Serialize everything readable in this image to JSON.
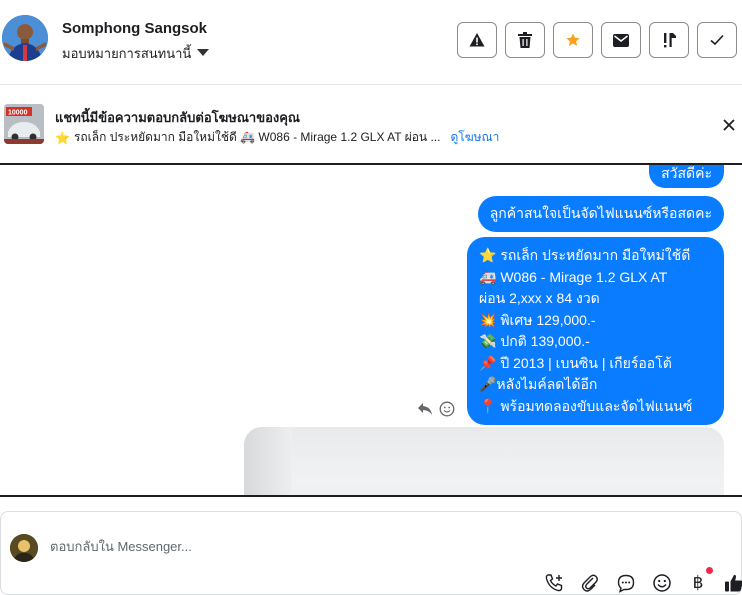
{
  "header": {
    "contact_name": "Somphong Sangsok",
    "assign_label": "มอบหมายการสนทนานี้",
    "actions": [
      {
        "icon": "warning-icon"
      },
      {
        "icon": "trash-icon"
      },
      {
        "icon": "star-icon",
        "color": "#f7a21b"
      },
      {
        "icon": "mail-icon"
      },
      {
        "icon": "follow-up-icon"
      },
      {
        "icon": "check-icon"
      }
    ]
  },
  "ad_banner": {
    "title": "แชทนี้มีข้อความตอบกลับต่อโฆษณาของคุณ",
    "subtitle": "รถเล็ก ประหยัดมาก มือใหม่ใช้ดี 🚑 W086 - Mirage 1.2 GLX AT ผ่อน ...",
    "link": "ดูโฆษณา",
    "thumb_text": "10000"
  },
  "messages": {
    "m1": "สวัสดีค่ะ",
    "m2": "ลูกค้าสนใจเป็นจัดไฟแนนซ์หรือสดคะ",
    "m3": [
      "⭐ รถเล็ก ประหยัดมาก มือใหม่ใช้ดี",
      "🚑 W086 - Mirage 1.2 GLX AT",
      "ผ่อน 2,xxx x 84 งวด",
      "💥 พิเศษ 129,000.-",
      "💸 ปกติ 139,000.-",
      "📌 ปี 2013 | เบนซิน | เกียร์ออโต้",
      "🎤หลังไมค์ลดได้อีก",
      "📍 พร้อมทดลองขับและจัดไฟแนนซ์"
    ]
  },
  "composer": {
    "placeholder": "ตอบกลับใน Messenger..."
  },
  "colors": {
    "accent": "#0a7cff",
    "link": "#1877f2",
    "notification_dot": "#f02849"
  }
}
